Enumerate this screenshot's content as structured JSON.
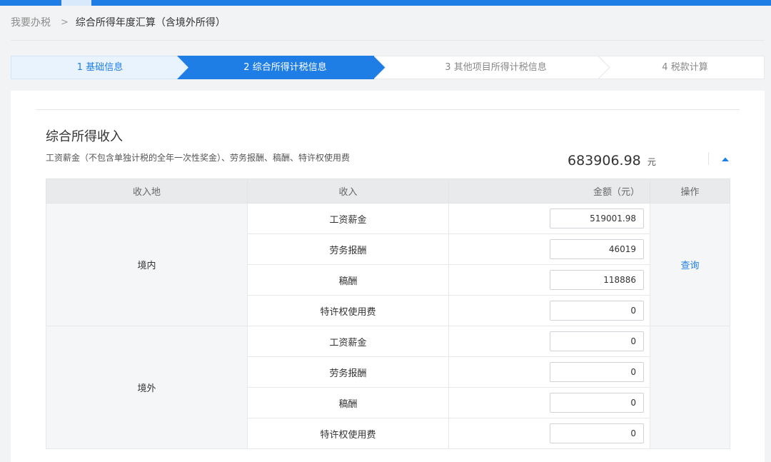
{
  "breadcrumb": {
    "home": "我要办税",
    "separator": ">",
    "current": "综合所得年度汇算（含境外所得）"
  },
  "steps": [
    {
      "label": "1 基础信息",
      "state": "done"
    },
    {
      "label": "2 综合所得计税信息",
      "state": "active"
    },
    {
      "label": "3 其他项目所得计税信息",
      "state": "todo"
    },
    {
      "label": "4 税款计算",
      "state": "todo"
    }
  ],
  "section": {
    "title": "综合所得收入",
    "description": "工资薪金（不包含单独计税的全年一次性奖金）、劳务报酬、稿酬、特许权使用费",
    "total": "683906.98",
    "unit": "元",
    "collapse_icon": "caret-up-icon"
  },
  "table": {
    "headers": {
      "region": "收入地",
      "income": "收入",
      "amount": "金额（元）",
      "action": "操作"
    },
    "groups": [
      {
        "region": "境内",
        "action": "查询",
        "rows": [
          {
            "item": "工资薪金",
            "amount": "519001.98"
          },
          {
            "item": "劳务报酬",
            "amount": "46019"
          },
          {
            "item": "稿酬",
            "amount": "118886"
          },
          {
            "item": "特许权使用费",
            "amount": "0"
          }
        ]
      },
      {
        "region": "境外",
        "action": "",
        "rows": [
          {
            "item": "工资薪金",
            "amount": "0"
          },
          {
            "item": "劳务报酬",
            "amount": "0"
          },
          {
            "item": "稿酬",
            "amount": "0"
          },
          {
            "item": "特许权使用费",
            "amount": "0"
          }
        ]
      }
    ]
  },
  "colors": {
    "brand": "#1f7ee6",
    "done_step_bg": "#e8f3fd",
    "link": "#1f7ee6"
  }
}
